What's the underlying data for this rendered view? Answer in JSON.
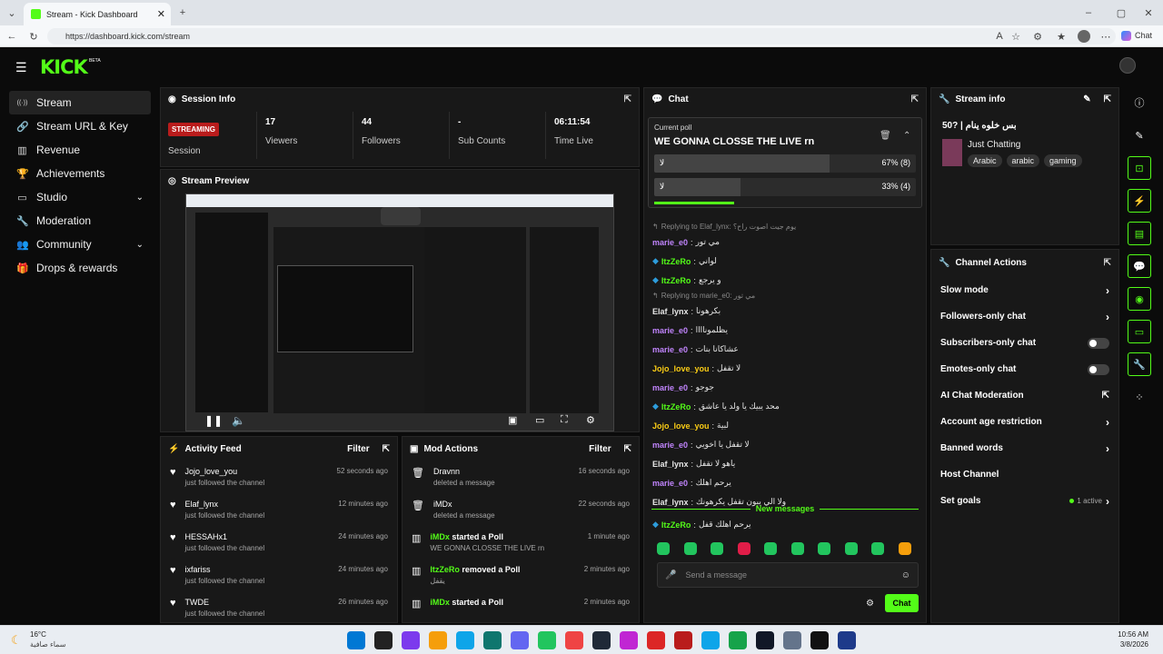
{
  "browser": {
    "tab_title": "Stream - Kick Dashboard",
    "url": "https://dashboard.kick.com/stream",
    "profile_label": "Chat"
  },
  "app": {
    "logo": "KICK",
    "beta": "BETA"
  },
  "sidebar": {
    "items": [
      {
        "label": "Stream",
        "icon": "signal-icon",
        "active": true
      },
      {
        "label": "Stream URL & Key",
        "icon": "link-icon"
      },
      {
        "label": "Revenue",
        "icon": "revenue-icon"
      },
      {
        "label": "Achievements",
        "icon": "trophy-icon"
      },
      {
        "label": "Studio",
        "icon": "studio-icon",
        "chevron": true
      },
      {
        "label": "Moderation",
        "icon": "wrench-icon"
      },
      {
        "label": "Community",
        "icon": "community-icon",
        "chevron": true
      },
      {
        "label": "Drops & rewards",
        "icon": "gift-icon"
      }
    ]
  },
  "session": {
    "title": "Session Info",
    "badge": "STREAMING",
    "badge_label": "Session",
    "stats": [
      {
        "value": "17",
        "label": "Viewers"
      },
      {
        "value": "44",
        "label": "Followers"
      },
      {
        "value": "-",
        "label": "Sub Counts"
      },
      {
        "value": "06:11:54",
        "label": "Time Live"
      }
    ]
  },
  "preview": {
    "title": "Stream Preview"
  },
  "activity": {
    "title": "Activity Feed",
    "filter": "Filter",
    "items": [
      {
        "user": "Jojo_love_you",
        "sub": "just followed the channel",
        "time": "52 seconds ago"
      },
      {
        "user": "Elaf_lynx",
        "sub": "just followed the channel",
        "time": "12 minutes ago"
      },
      {
        "user": "HESSAHx1",
        "sub": "just followed the channel",
        "time": "24 minutes ago"
      },
      {
        "user": "ixfariss",
        "sub": "just followed the channel",
        "time": "24 minutes ago"
      },
      {
        "user": "TWDE",
        "sub": "just followed the channel",
        "time": "26 minutes ago"
      }
    ]
  },
  "mod": {
    "title": "Mod Actions",
    "filter": "Filter",
    "items": [
      {
        "user": "Dravnn",
        "action": "",
        "sub": "deleted a message",
        "time": "16 seconds ago"
      },
      {
        "user": "iMDx",
        "action": "",
        "sub": "deleted a message",
        "time": "22 seconds ago"
      },
      {
        "user": "iMDx",
        "action": " started a Poll",
        "sub": "WE GONNA CLOSSE THE LIVE rn",
        "time": "1 minute ago"
      },
      {
        "user": "ItzZeRo",
        "action": " removed a Poll",
        "sub": "يقفل",
        "time": "2 minutes ago"
      },
      {
        "user": "iMDx",
        "action": " started a Poll",
        "sub": "",
        "time": "2 minutes ago"
      }
    ]
  },
  "chat": {
    "title": "Chat",
    "poll_label": "Current poll",
    "poll_q": "WE GONNA CLOSSE THE LIVE rn",
    "options": [
      {
        "label": "لا",
        "pct": "67% (8)",
        "fill": 0.67
      },
      {
        "label": "لا",
        "pct": "33% (4)",
        "fill": 0.33
      }
    ],
    "messages": [
      {
        "reply": "Replying to Elaf_lynx: يوم جيت اصوت راح؟"
      },
      {
        "user": "marie_e0",
        "color": "#c084fc",
        "text": "مي تور"
      },
      {
        "user": "ItzZeRo",
        "color": "#53fc18",
        "text": "لواني",
        "badge": true
      },
      {
        "user": "ItzZeRo",
        "color": "#53fc18",
        "text": "و يرجع",
        "badge": true
      },
      {
        "reply": "Replying to marie_e0: مي تور"
      },
      {
        "user": "Elaf_lynx",
        "color": "#e7e7e7",
        "text": "بكرهونا"
      },
      {
        "user": "marie_e0",
        "color": "#c084fc",
        "text": "يظلموناااا"
      },
      {
        "user": "marie_e0",
        "color": "#c084fc",
        "text": "عشاكانا بنات"
      },
      {
        "user": "Jojo_love_you",
        "color": "#facc15",
        "text": "لا تقفل"
      },
      {
        "user": "marie_e0",
        "color": "#c084fc",
        "text": "جوجو"
      },
      {
        "user": "ItzZeRo",
        "color": "#53fc18",
        "text": "محد يبيك يا ولد يا عاشق",
        "badge": true
      },
      {
        "user": "Jojo_love_you",
        "color": "#facc15",
        "text": "لبية"
      },
      {
        "user": "marie_e0",
        "color": "#c084fc",
        "text": "لا تقفل يا اخويي"
      },
      {
        "user": "Elaf_lynx",
        "color": "#e7e7e7",
        "text": "ياهو لا تقفل"
      },
      {
        "user": "marie_e0",
        "color": "#c084fc",
        "text": "يرحم اهلك"
      },
      {
        "user": "Elaf_lynx",
        "color": "#e7e7e7",
        "text": "ولا الي يبون تقفل يكرهونك"
      }
    ],
    "new_messages": "New messages",
    "after": {
      "user": "ItzZeRo",
      "color": "#53fc18",
      "text": "يرحم اهلك قفل"
    },
    "placeholder": "Send a message",
    "send": "Chat"
  },
  "info": {
    "title": "Stream info",
    "stream_title": "بس خلوه ينام | ?50",
    "category": "Just Chatting",
    "tags": [
      "Arabic",
      "arabic",
      "gaming"
    ]
  },
  "actions": {
    "title": "Channel Actions",
    "items": [
      {
        "label": "Slow mode",
        "type": "chevron"
      },
      {
        "label": "Followers-only chat",
        "type": "chevron"
      },
      {
        "label": "Subscribers-only chat",
        "type": "toggle"
      },
      {
        "label": "Emotes-only chat",
        "type": "toggle"
      },
      {
        "label": "AI Chat Moderation",
        "type": "external"
      },
      {
        "label": "Account age restriction",
        "type": "chevron"
      },
      {
        "label": "Banned words",
        "type": "chevron"
      },
      {
        "label": "Host Channel",
        "type": "none"
      },
      {
        "label": "Set goals",
        "type": "goals",
        "extra": "1 active"
      }
    ]
  },
  "weather": {
    "temp": "16°C",
    "desc": "سماء صافية"
  },
  "clock": {
    "time": "10:56 AM",
    "date": "3/8/2026"
  }
}
